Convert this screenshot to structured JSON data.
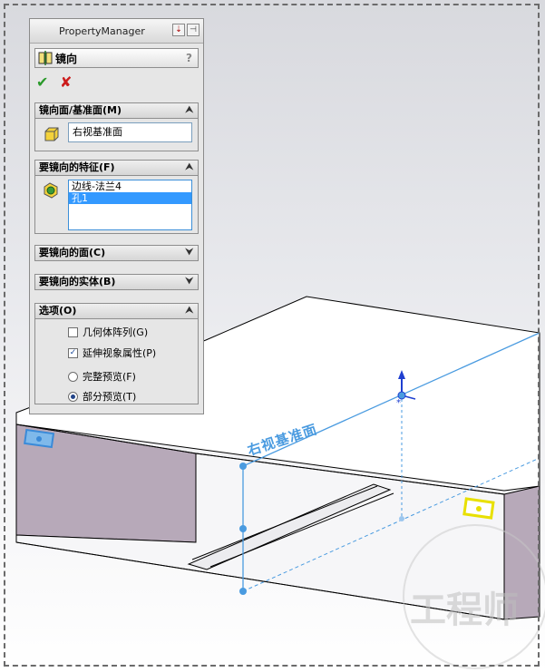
{
  "property_manager": {
    "title": "PropertyManager",
    "feature_name": "镜向",
    "help": "?",
    "ok_icon": "check-icon",
    "cancel_icon": "close-icon"
  },
  "sections": {
    "mirror_plane": {
      "label": "镜向面/基准面(M)",
      "value": "右视基准面",
      "state": "expanded"
    },
    "features": {
      "label": "要镜向的特征(F)",
      "items": [
        "边线-法兰4",
        "孔1"
      ],
      "selected": "孔1",
      "state": "expanded"
    },
    "faces": {
      "label": "要镜向的面(C)",
      "state": "collapsed"
    },
    "bodies": {
      "label": "要镜向的实体(B)",
      "state": "collapsed"
    },
    "options": {
      "label": "选项(O)",
      "state": "expanded",
      "geometry_pattern": {
        "label": "几何体阵列(G)",
        "checked": false
      },
      "propagate_visual": {
        "label": "延伸视象属性(P)",
        "checked": true
      },
      "full_preview": {
        "label": "完整预览(F)",
        "selected": false
      },
      "partial_preview": {
        "label": "部分预览(T)",
        "selected": true
      }
    }
  },
  "viewport": {
    "plane_label": "右视基准面"
  },
  "colors": {
    "preview_blue": "#4a9be0",
    "selection_yellow": "#e8e000",
    "part_face": "#b7a9b9",
    "list_select": "#3399ff"
  }
}
